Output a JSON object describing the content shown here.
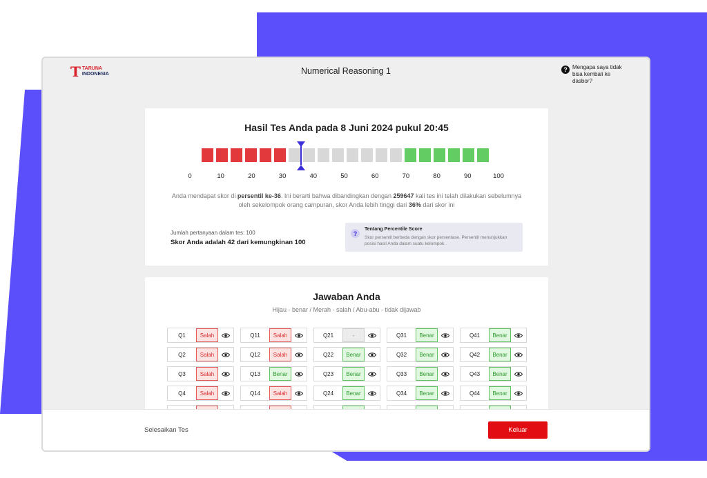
{
  "colors": {
    "accent": "#5a4ffb",
    "exit_button": "#e10d12",
    "wrong": "#e23a3c",
    "correct": "#63cc63",
    "unanswered": "#d8d8d8",
    "marker": "#3d2fd8"
  },
  "header": {
    "logo": {
      "mark": "T",
      "line1": "TARUNA",
      "line2": "INDONESIA"
    },
    "title": "Numerical Reasoning 1",
    "help": {
      "icon": "question-circle-icon",
      "text": "Mengapa saya tidak bisa kembali ke dasbor?"
    }
  },
  "result": {
    "title": "Hasil Tes Anda pada 8 Juni 2024 pukul 20:45",
    "percentile": 36,
    "segments": [
      "red",
      "red",
      "red",
      "red",
      "red",
      "red",
      "gray",
      "gray",
      "gray",
      "gray",
      "gray",
      "gray",
      "gray",
      "gray",
      "green",
      "green",
      "green",
      "green",
      "green",
      "green"
    ],
    "ticks": [
      "0",
      "10",
      "20",
      "30",
      "40",
      "50",
      "60",
      "70",
      "80",
      "90",
      "100"
    ],
    "description": {
      "p1": "Anda mendapat skor di ",
      "b1": "persentil ke-36",
      "p2": ". Ini berarti bahwa dibandingkan dengan ",
      "b2": "259647",
      "p3": " kali tes ini telah dilakukan sebelumnya oleh sekelompok orang campuran, skor Anda lebih tinggi dari ",
      "b3": "36%",
      "p4": " dari skor ini"
    },
    "question_count": "Jumlah pertanyaan dalam tes: 100",
    "score": "Skor Anda adalah 42 dari kemungkinan 100",
    "info": {
      "icon": "question-icon",
      "title": "Tentang Percentile Score",
      "text": "Skor persentil berbeda dengan skor persentase. Persentil menunjukkan posisi hasil Anda dalam suatu kelompok."
    }
  },
  "answers": {
    "title": "Jawaban Anda",
    "legend": "Hijau - benar / Merah - salah / Abu-abu - tidak dijawab",
    "columns": [
      [
        {
          "q": "Q1",
          "s": "Salah",
          "t": "salah"
        },
        {
          "q": "Q2",
          "s": "Salah",
          "t": "salah"
        },
        {
          "q": "Q3",
          "s": "Salah",
          "t": "salah"
        },
        {
          "q": "Q4",
          "s": "Salah",
          "t": "salah"
        },
        {
          "q": "",
          "s": "",
          "t": "salah"
        }
      ],
      [
        {
          "q": "Q11",
          "s": "Salah",
          "t": "salah"
        },
        {
          "q": "Q12",
          "s": "Salah",
          "t": "salah"
        },
        {
          "q": "Q13",
          "s": "Benar",
          "t": "benar"
        },
        {
          "q": "Q14",
          "s": "Salah",
          "t": "salah"
        },
        {
          "q": "",
          "s": "",
          "t": "salah"
        }
      ],
      [
        {
          "q": "Q21",
          "s": "-",
          "t": "none"
        },
        {
          "q": "Q22",
          "s": "Benar",
          "t": "benar"
        },
        {
          "q": "Q23",
          "s": "Benar",
          "t": "benar"
        },
        {
          "q": "Q24",
          "s": "Benar",
          "t": "benar"
        },
        {
          "q": "",
          "s": "",
          "t": "benar"
        }
      ],
      [
        {
          "q": "Q31",
          "s": "Benar",
          "t": "benar"
        },
        {
          "q": "Q32",
          "s": "Benar",
          "t": "benar"
        },
        {
          "q": "Q33",
          "s": "Benar",
          "t": "benar"
        },
        {
          "q": "Q34",
          "s": "Benar",
          "t": "benar"
        },
        {
          "q": "",
          "s": "",
          "t": "benar"
        }
      ],
      [
        {
          "q": "Q41",
          "s": "Benar",
          "t": "benar"
        },
        {
          "q": "Q42",
          "s": "Benar",
          "t": "benar"
        },
        {
          "q": "Q43",
          "s": "Benar",
          "t": "benar"
        },
        {
          "q": "Q44",
          "s": "Benar",
          "t": "benar"
        },
        {
          "q": "",
          "s": "",
          "t": "benar"
        }
      ]
    ],
    "view_icon": "eye-icon"
  },
  "footer": {
    "finish_label": "Selesaikan Tes",
    "exit_label": "Keluar"
  }
}
